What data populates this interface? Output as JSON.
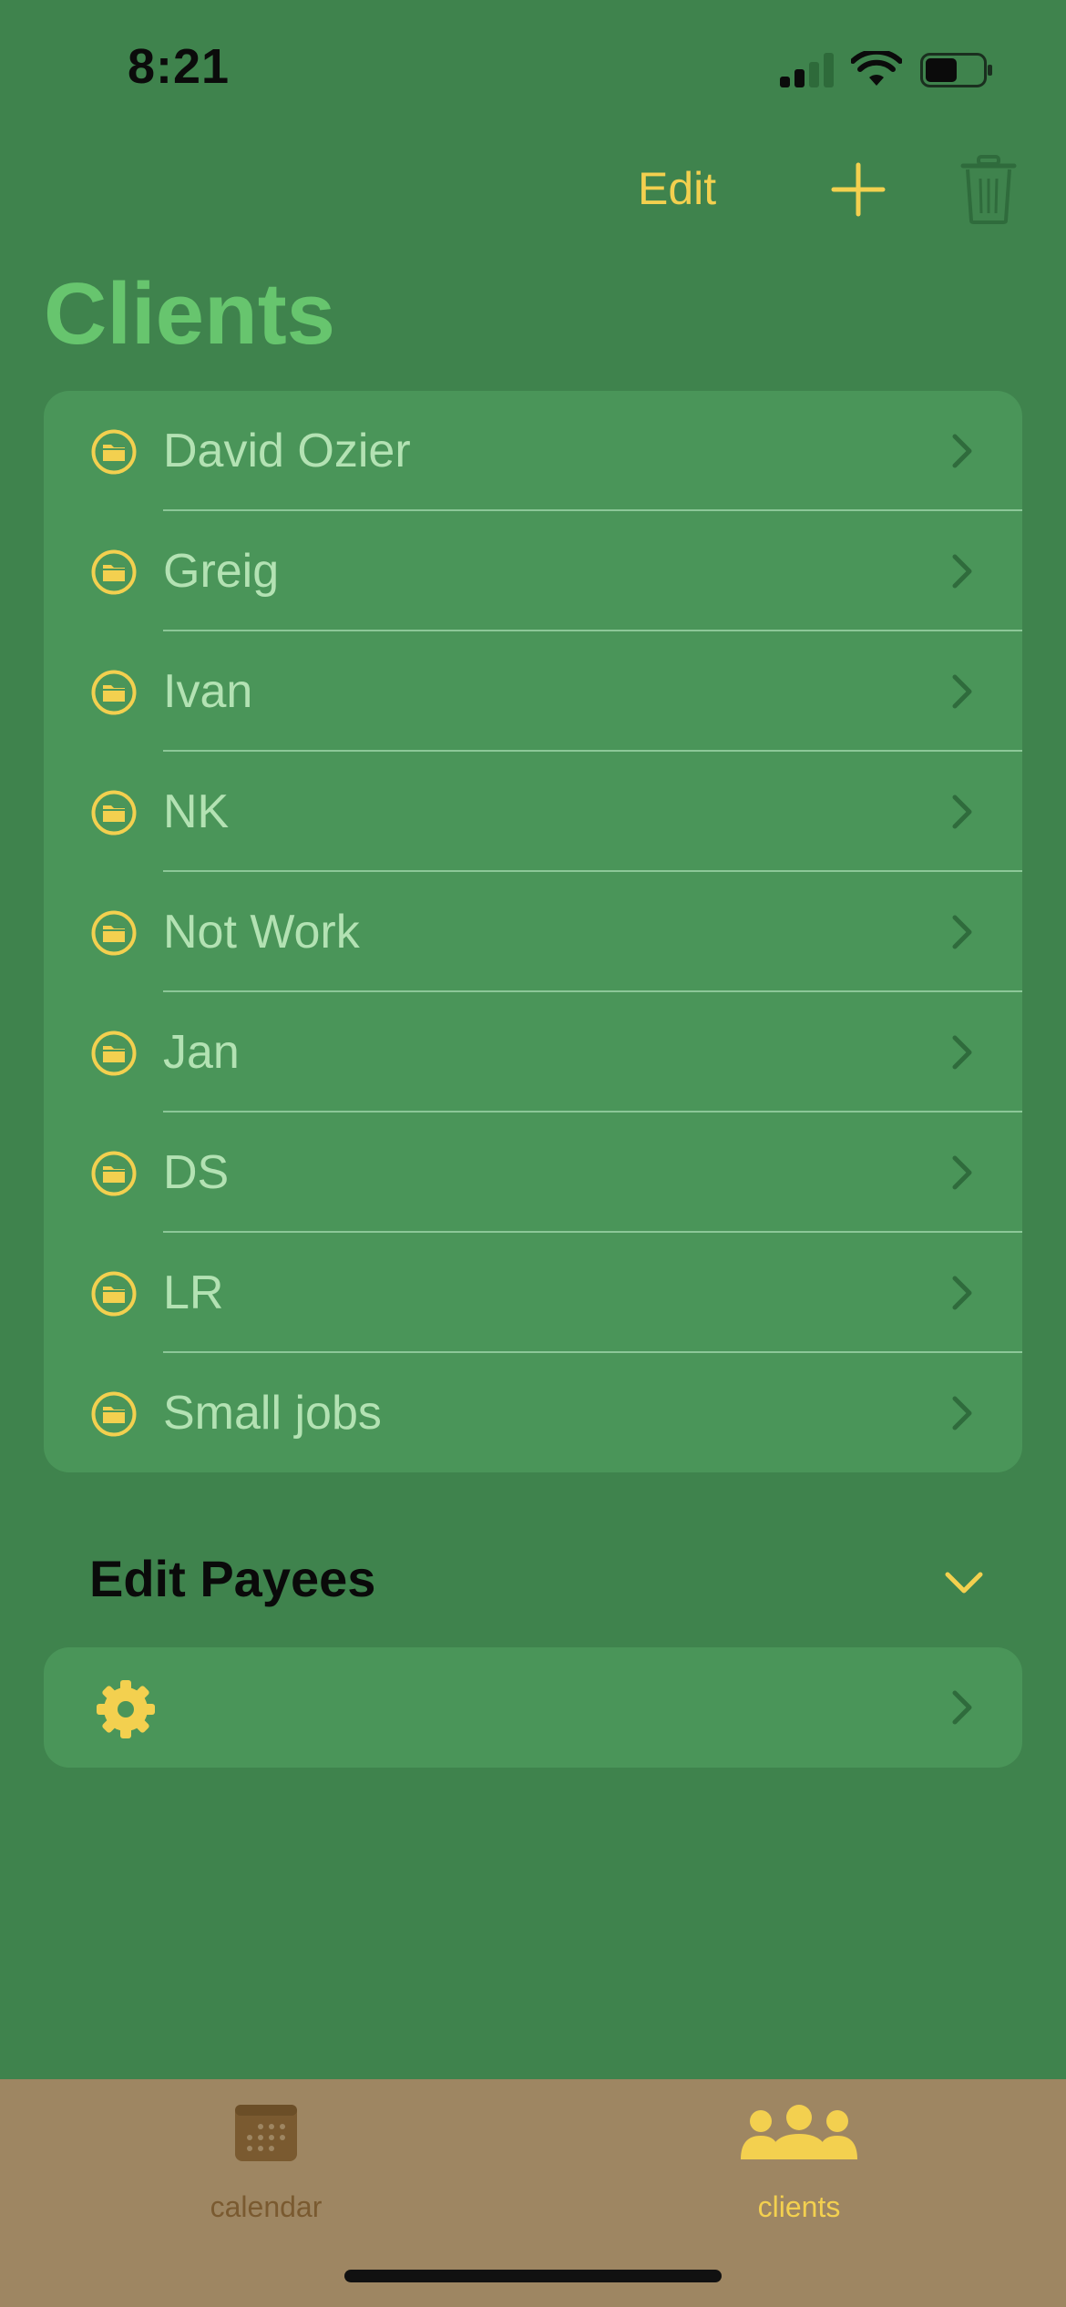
{
  "status_bar": {
    "time": "8:21",
    "signal_bars": 2,
    "battery_level": 0.5
  },
  "nav_bar": {
    "edit_label": "Edit"
  },
  "page_title": "Clients",
  "clients": [
    {
      "name": "David Ozier",
      "icon": "folder-icon"
    },
    {
      "name": "Greig",
      "icon": "folder-icon"
    },
    {
      "name": "Ivan",
      "icon": "folder-icon"
    },
    {
      "name": "NK",
      "icon": "folder-icon"
    },
    {
      "name": "Not Work",
      "icon": "folder-icon"
    },
    {
      "name": "Jan",
      "icon": "folder-icon"
    },
    {
      "name": "DS",
      "icon": "folder-icon"
    },
    {
      "name": "LR",
      "icon": "folder-icon"
    },
    {
      "name": "Small jobs",
      "icon": "folder-icon"
    }
  ],
  "payees_section": {
    "title": "Edit Payees",
    "settings_icon": "gear-icon"
  },
  "tab_bar": {
    "tabs": [
      {
        "label": "calendar",
        "icon": "calendar-icon",
        "selected": false
      },
      {
        "label": "clients",
        "icon": "people-icon",
        "selected": true
      }
    ]
  },
  "colors": {
    "background": "#3f834d",
    "card": "#4a9559",
    "accent": "#f3d04f",
    "title": "#67c56e",
    "row_text": "#b3e2b3",
    "tab_bar": "#9e8662"
  }
}
